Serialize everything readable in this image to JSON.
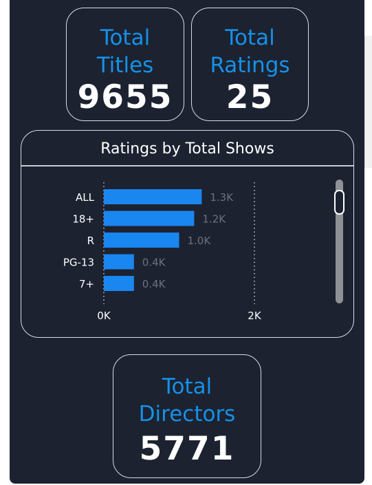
{
  "kpis": {
    "titles": {
      "label_line1": "Total",
      "label_line2": "Titles",
      "value": "9655"
    },
    "ratings": {
      "label_line1": "Total",
      "label_line2": "Ratings",
      "value": "25"
    },
    "directors": {
      "label_line1": "Total",
      "label_line2": "Directors",
      "value": "5771"
    }
  },
  "colors": {
    "background": "#1c2230",
    "accent": "#1591e8",
    "bar": "#1a86f0",
    "data_label": "#6b7280"
  },
  "chart_data": {
    "type": "bar",
    "orientation": "horizontal",
    "title": "Ratings by Total Shows",
    "categories": [
      "ALL",
      "18+",
      "R",
      "PG-13",
      "7+"
    ],
    "values": [
      1300,
      1200,
      1000,
      400,
      400
    ],
    "data_labels": [
      "1.3K",
      "1.2K",
      "1.0K",
      "0.4K",
      "0.4K"
    ],
    "xlim": [
      0,
      2000
    ],
    "x_ticks": [
      0,
      2000
    ],
    "x_tick_labels": [
      "0K",
      "2K"
    ],
    "grid": true,
    "legend": "none"
  }
}
